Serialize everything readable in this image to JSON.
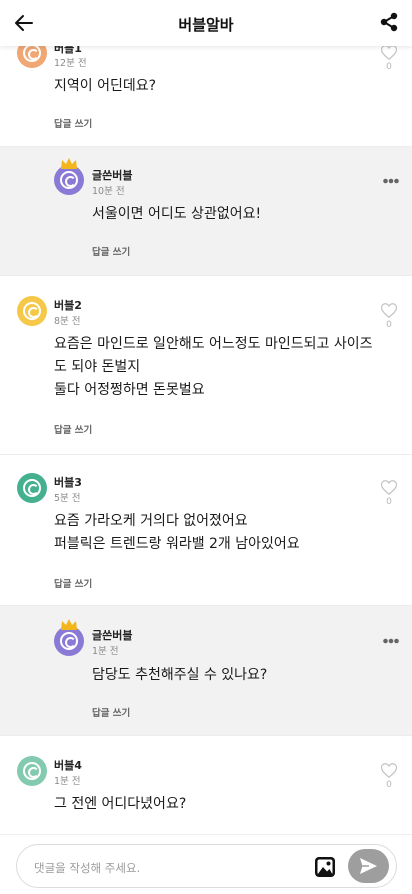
{
  "header": {
    "title": "버블알바",
    "back_icon": "arrow-left-icon",
    "share_icon": "share-icon"
  },
  "comments": [
    {
      "author": "버블1",
      "time": "12분 전",
      "lines": [
        "지역이 어딘데요?"
      ],
      "reply_label": "답글 쓰기",
      "likes": "0",
      "avatar_color": "#f0a774",
      "is_reply": false
    },
    {
      "author": "글쓴버블",
      "time": "10분 전",
      "lines": [
        "서울이면 어디도 상관없어요!"
      ],
      "reply_label": "답글 쓰기",
      "avatar_color": "#8a7ad6",
      "is_reply": true,
      "crown_color": "#f2b51c"
    },
    {
      "author": "버블2",
      "time": "8분 전",
      "lines": [
        "요즘은 마인드로 일안해도 어느정도 마인드되고 사이즈",
        "도 되야 돈벌지",
        "둘다 어정쩡하면 돈못벌요"
      ],
      "reply_label": "답글 쓰기",
      "likes": "0",
      "avatar_color": "#f5c84a",
      "is_reply": false
    },
    {
      "author": "버블3",
      "time": "5분 전",
      "lines": [
        "요즘 가라오케 거의다 없어졌어요",
        "퍼블릭은 트렌드랑 워라밸 2개 남아있어요"
      ],
      "reply_label": "답글 쓰기",
      "likes": "0",
      "avatar_color": "#44b08e",
      "is_reply": false
    },
    {
      "author": "글쓴버블",
      "time": "1분 전",
      "lines": [
        "담당도 추천해주실 수 있나요?"
      ],
      "reply_label": "답글 쓰기",
      "avatar_color": "#8a7ad6",
      "is_reply": true,
      "crown_color": "#f2b51c"
    },
    {
      "author": "버블4",
      "time": "1분 전",
      "lines": [
        "그 전엔 어디다녔어요?"
      ],
      "likes": "0",
      "avatar_color": "#83cbb0",
      "is_reply": false
    }
  ],
  "input": {
    "placeholder": "댓글을 작성해 주세요.",
    "photo_icon": "image-icon",
    "send_icon": "send-icon"
  }
}
